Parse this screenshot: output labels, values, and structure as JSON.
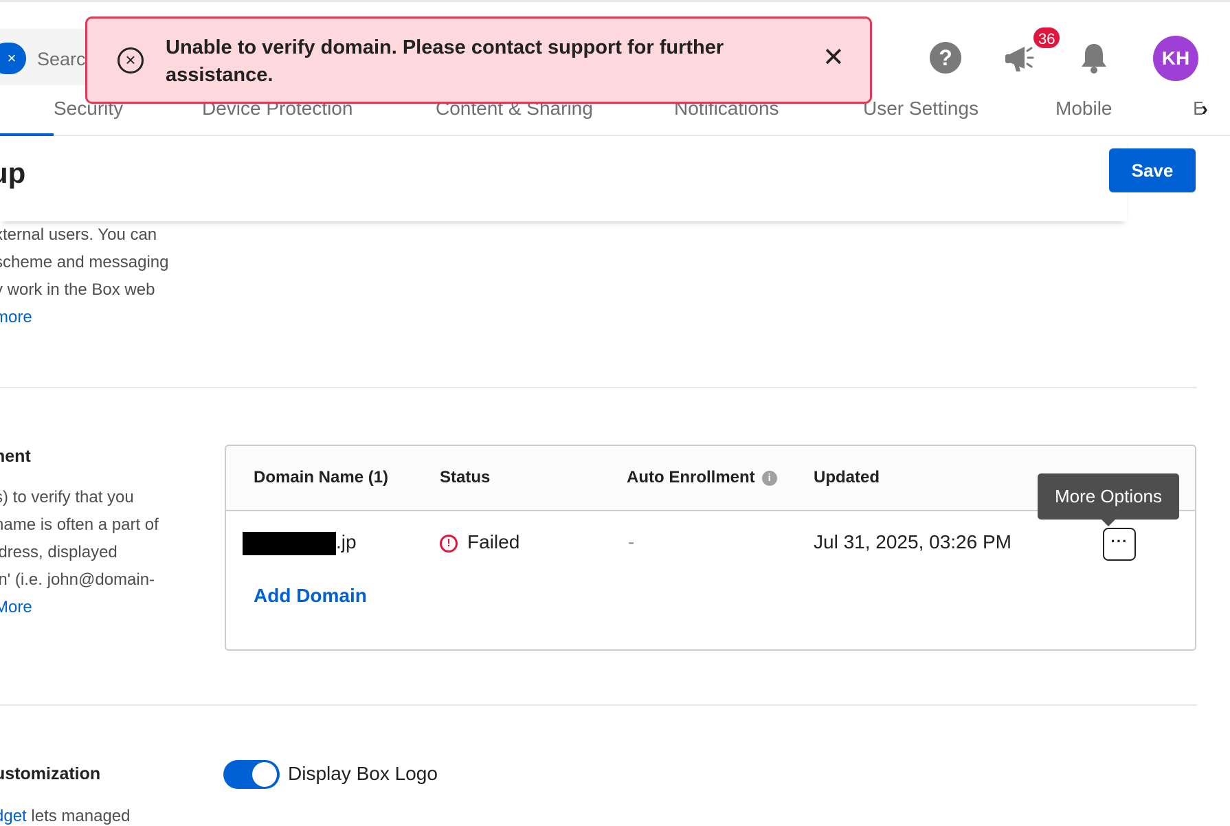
{
  "header": {
    "search_placeholder": "Search",
    "search_clear_icon": "×",
    "help_icon": "?",
    "announcement_badge": "36",
    "avatar_initials": "KH",
    "avatar_color": "#9e40d6"
  },
  "tabs": [
    {
      "label": "Security",
      "active": true
    },
    {
      "label": "Device Protection"
    },
    {
      "label": "Content & Sharing"
    },
    {
      "label": "Notifications"
    },
    {
      "label": "User Settings"
    },
    {
      "label": "Mobile"
    },
    {
      "label": "E"
    }
  ],
  "tabs_next_icon": "›",
  "page": {
    "title": "up",
    "save_label": "Save"
  },
  "section1": {
    "desc_lines": [
      "xternal users. You can",
      "scheme and messaging",
      "y work in the Box web"
    ],
    "more_link": "more"
  },
  "section2": {
    "heading": "nent",
    "desc_lines": [
      "s) to verify that you",
      "name is often a part of",
      "ldress, displayed",
      "in' (i.e. john@domain-"
    ],
    "more_link": "More"
  },
  "domain_table": {
    "columns": [
      "Domain Name (1)",
      "Status",
      "Auto Enrollment",
      "Updated"
    ],
    "info_icon": "i",
    "rows": [
      {
        "domain_suffix": ".jp",
        "status_icon": "!",
        "status": "Failed",
        "auto_enrollment": "-",
        "updated": "Jul 31, 2025, 03:26 PM",
        "more_icon": "···"
      }
    ],
    "add_domain_label": "Add Domain"
  },
  "tooltip": {
    "text": "More Options"
  },
  "section3": {
    "heading": "ustomization",
    "desc_link": "dget",
    "desc_text": " lets managed",
    "toggle_label": "Display Box Logo",
    "toggle_on": true
  },
  "toast": {
    "message": "Unable to verify domain. Please contact support for further assistance.",
    "error_icon": "×",
    "close_icon": "✕"
  },
  "colors": {
    "accent": "#0061d5",
    "error_bg": "#fdd8dd",
    "error_border": "#e03a5a",
    "badge": "#e1163c"
  }
}
